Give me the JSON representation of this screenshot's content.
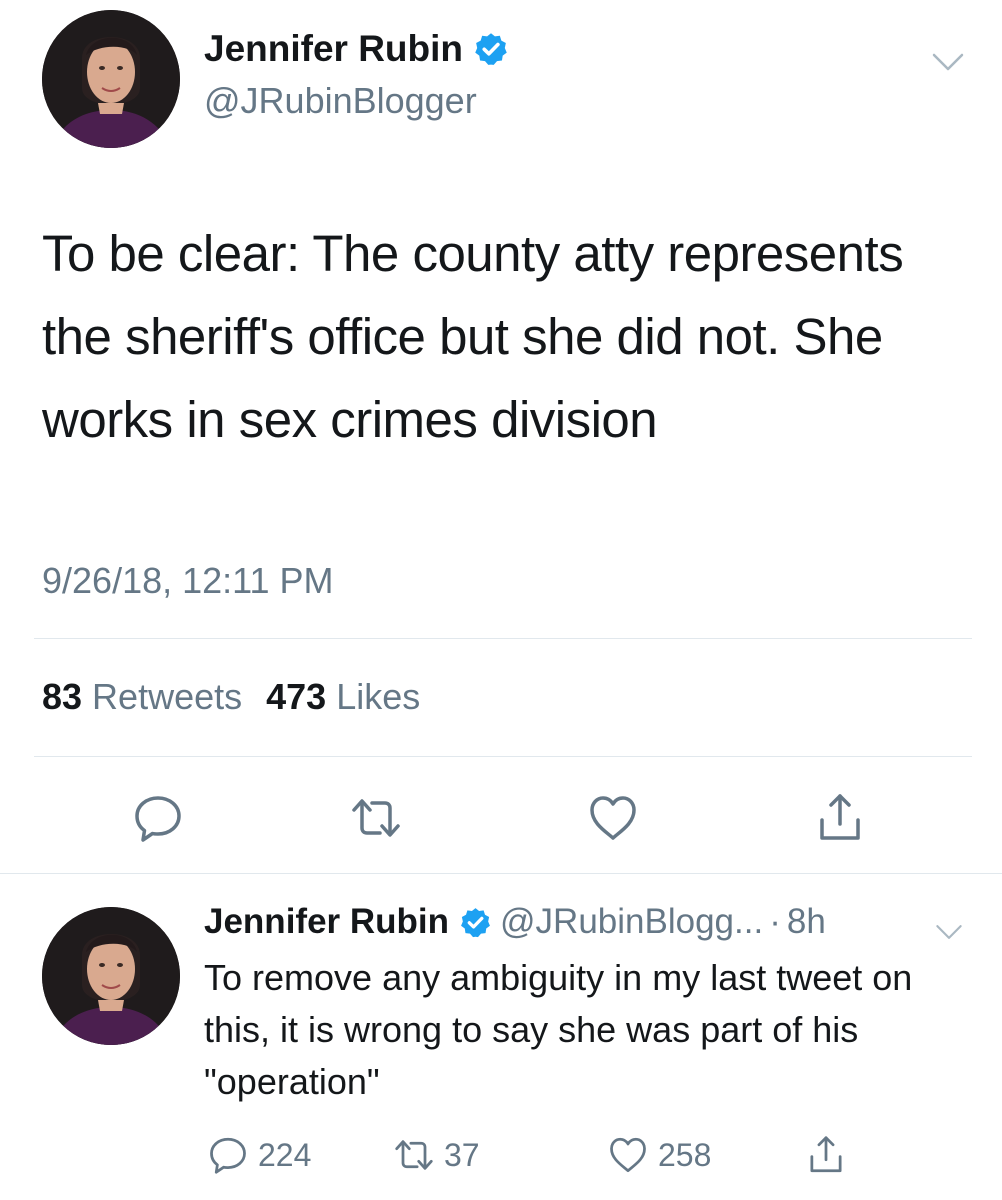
{
  "main_tweet": {
    "author_name": "Jennifer Rubin",
    "handle": "@JRubinBlogger",
    "text": "To be clear: The county atty represents the sheriff's office but she did not. She works in sex crimes division",
    "timestamp": "9/26/18, 12:11 PM",
    "retweets_count": "83",
    "retweets_label": "Retweets",
    "likes_count": "473",
    "likes_label": "Likes",
    "icons": [
      "reply-icon",
      "retweet-icon",
      "like-icon",
      "share-icon"
    ]
  },
  "reply_tweet": {
    "author_name": "Jennifer Rubin",
    "handle": "@JRubinBlogg...",
    "separator": "·",
    "time": "8h",
    "text": "To remove any ambiguity in my last tweet on this, it is wrong to say she was part of his \"operation\"",
    "reply_count": "224",
    "retweet_count": "37",
    "like_count": "258"
  },
  "colors": {
    "text": "#14171a",
    "secondary": "#657786",
    "divider": "#e1e8ed",
    "verified_blue": "#1da1f2"
  }
}
